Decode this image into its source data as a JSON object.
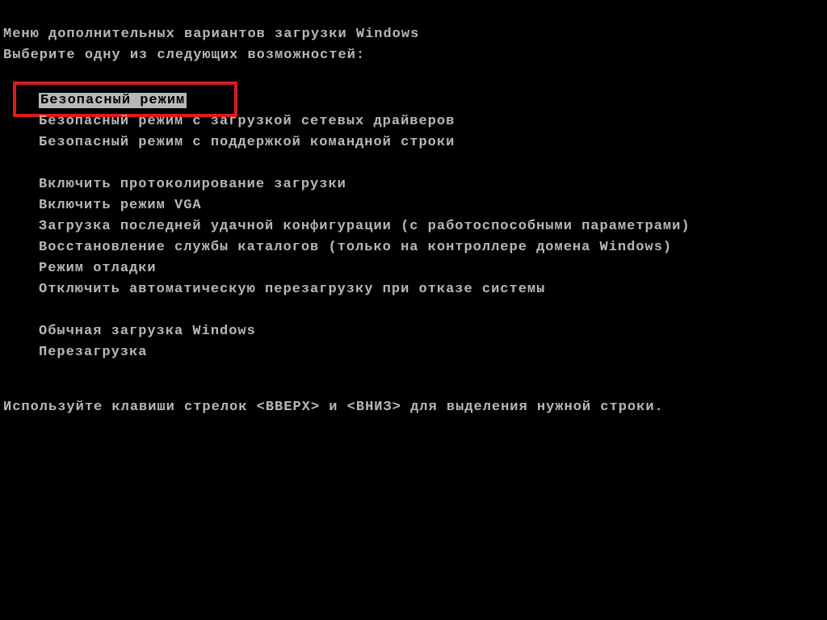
{
  "title": "Меню дополнительных вариантов загрузки Windows",
  "subtitle": "Выберите одну из следующих возможностей:",
  "groups": [
    {
      "items": [
        {
          "label": "Безопасный режим",
          "selected": true,
          "highlighted": true
        },
        {
          "label": "Безопасный режим с загрузкой сетевых драйверов"
        },
        {
          "label": "Безопасный режим с поддержкой командной строки"
        }
      ]
    },
    {
      "items": [
        {
          "label": "Включить протоколирование загрузки"
        },
        {
          "label": "Включить режим VGA"
        },
        {
          "label": "Загрузка последней удачной конфигурации (с работоспособными параметрами)"
        },
        {
          "label": "Восстановление службы каталогов (только на контроллере домена Windows)"
        },
        {
          "label": "Режим отладки"
        },
        {
          "label": "Отключить автоматическую перезагрузку при отказе системы"
        }
      ]
    },
    {
      "items": [
        {
          "label": "Обычная загрузка Windows"
        },
        {
          "label": "Перезагрузка"
        }
      ]
    }
  ],
  "footer": "Используйте клавиши стрелок <ВВЕРХ> и <ВНИЗ> для выделения нужной строки.",
  "colors": {
    "background": "#000000",
    "text": "#b8b8b8",
    "highlight_box": "#d91c1c"
  }
}
